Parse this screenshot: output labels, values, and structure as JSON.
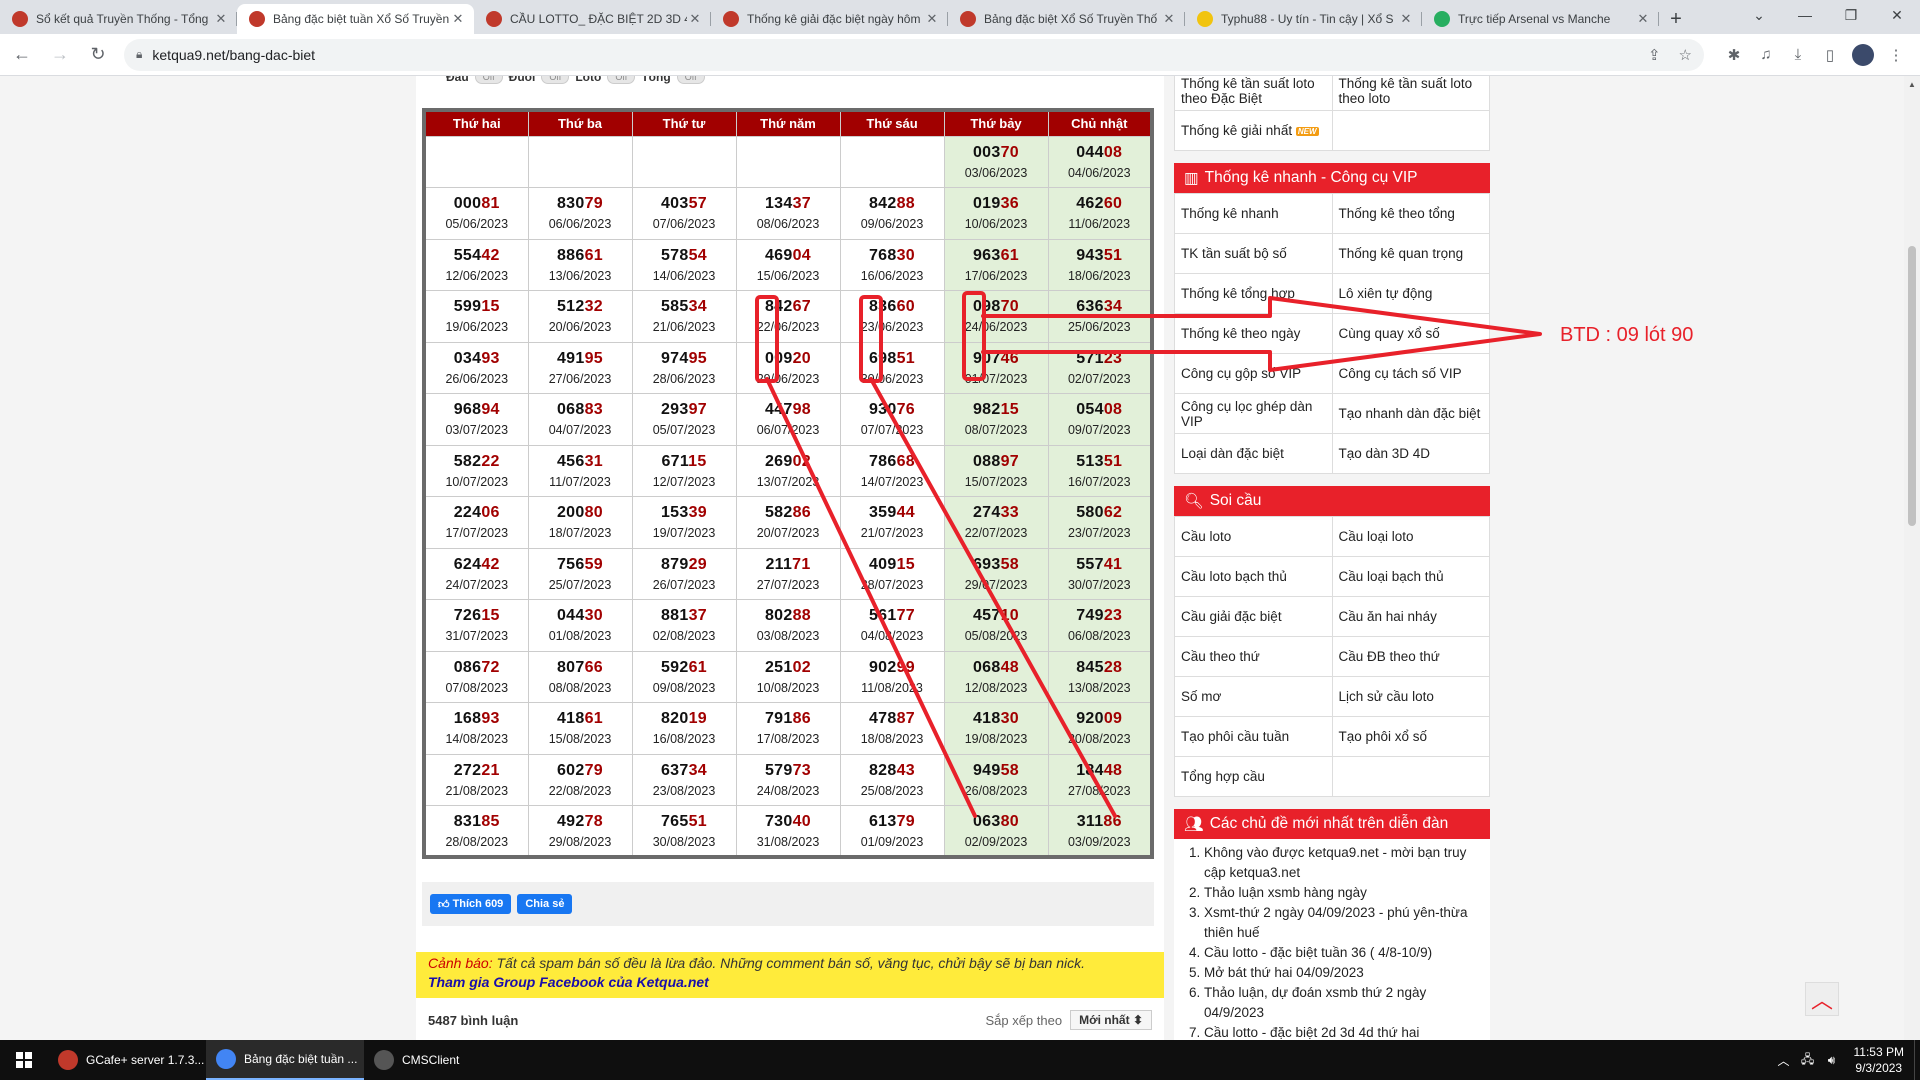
{
  "browser": {
    "tabs": [
      {
        "title": "Sổ kết quả Truyền Thống - Tổng",
        "icon": "ketqua-favicon",
        "color": "#c0392b",
        "active": false
      },
      {
        "title": "Bảng đặc biệt tuần Xổ Số Truyền",
        "icon": "ketqua-favicon",
        "color": "#c0392b",
        "active": true
      },
      {
        "title": "CẦU LOTTO_ ĐẶC BIỆT 2D 3D 4D",
        "icon": "ketqua-favicon",
        "color": "#c0392b",
        "active": false
      },
      {
        "title": "Thống kê giải đặc biệt ngày hôm",
        "icon": "ketqua-favicon",
        "color": "#c0392b",
        "active": false
      },
      {
        "title": "Bảng đặc biệt Xổ Số Truyền Thố",
        "icon": "ketqua-favicon",
        "color": "#c0392b",
        "active": false
      },
      {
        "title": "Typhu88 - Uy tín - Tin cậy | Xổ S",
        "icon": "typhu-favicon",
        "color": "#f1c40f",
        "active": false
      },
      {
        "title": "Trực tiếp Arsenal vs Manche",
        "icon": "live-favicon",
        "color": "#27ae60",
        "active": false
      }
    ],
    "url": "ketqua9.net/bang-dac-biet"
  },
  "filters": {
    "labels": [
      "Đầu",
      "Đuôi",
      "Loto",
      "Tổng"
    ],
    "toggle_text": "Off"
  },
  "table": {
    "headers": [
      "Thứ hai",
      "Thứ ba",
      "Thứ tư",
      "Thứ năm",
      "Thứ sáu",
      "Thứ bảy",
      "Chủ nhật"
    ],
    "rows": [
      [
        {
          "num": "",
          "date": ""
        },
        {
          "num": "",
          "date": ""
        },
        {
          "num": "",
          "date": ""
        },
        {
          "num": "",
          "date": ""
        },
        {
          "num": "",
          "date": ""
        },
        {
          "num": "00370",
          "date": "03/06/2023"
        },
        {
          "num": "04408",
          "date": "04/06/2023"
        }
      ],
      [
        {
          "num": "00081",
          "date": "05/06/2023"
        },
        {
          "num": "83079",
          "date": "06/06/2023"
        },
        {
          "num": "40357",
          "date": "07/06/2023"
        },
        {
          "num": "13437",
          "date": "08/06/2023"
        },
        {
          "num": "84288",
          "date": "09/06/2023"
        },
        {
          "num": "01936",
          "date": "10/06/2023"
        },
        {
          "num": "46260",
          "date": "11/06/2023"
        }
      ],
      [
        {
          "num": "55442",
          "date": "12/06/2023"
        },
        {
          "num": "88661",
          "date": "13/06/2023"
        },
        {
          "num": "57854",
          "date": "14/06/2023"
        },
        {
          "num": "46904",
          "date": "15/06/2023"
        },
        {
          "num": "76830",
          "date": "16/06/2023"
        },
        {
          "num": "96361",
          "date": "17/06/2023"
        },
        {
          "num": "94351",
          "date": "18/06/2023"
        }
      ],
      [
        {
          "num": "59915",
          "date": "19/06/2023"
        },
        {
          "num": "51232",
          "date": "20/06/2023"
        },
        {
          "num": "58534",
          "date": "21/06/2023"
        },
        {
          "num": "84267",
          "date": "22/06/2023"
        },
        {
          "num": "83660",
          "date": "23/06/2023"
        },
        {
          "num": "09870",
          "date": "24/06/2023"
        },
        {
          "num": "63634",
          "date": "25/06/2023"
        }
      ],
      [
        {
          "num": "03493",
          "date": "26/06/2023"
        },
        {
          "num": "49195",
          "date": "27/06/2023"
        },
        {
          "num": "97495",
          "date": "28/06/2023"
        },
        {
          "num": "00920",
          "date": "29/06/2023"
        },
        {
          "num": "69851",
          "date": "30/06/2023"
        },
        {
          "num": "90746",
          "date": "01/07/2023"
        },
        {
          "num": "57123",
          "date": "02/07/2023"
        }
      ],
      [
        {
          "num": "96894",
          "date": "03/07/2023"
        },
        {
          "num": "06883",
          "date": "04/07/2023"
        },
        {
          "num": "29397",
          "date": "05/07/2023"
        },
        {
          "num": "44798",
          "date": "06/07/2023"
        },
        {
          "num": "93076",
          "date": "07/07/2023"
        },
        {
          "num": "98215",
          "date": "08/07/2023"
        },
        {
          "num": "05408",
          "date": "09/07/2023"
        }
      ],
      [
        {
          "num": "58222",
          "date": "10/07/2023"
        },
        {
          "num": "45631",
          "date": "11/07/2023"
        },
        {
          "num": "67115",
          "date": "12/07/2023"
        },
        {
          "num": "26902",
          "date": "13/07/2023"
        },
        {
          "num": "78668",
          "date": "14/07/2023"
        },
        {
          "num": "08897",
          "date": "15/07/2023"
        },
        {
          "num": "51351",
          "date": "16/07/2023"
        }
      ],
      [
        {
          "num": "22406",
          "date": "17/07/2023"
        },
        {
          "num": "20080",
          "date": "18/07/2023"
        },
        {
          "num": "15339",
          "date": "19/07/2023"
        },
        {
          "num": "58286",
          "date": "20/07/2023"
        },
        {
          "num": "35944",
          "date": "21/07/2023"
        },
        {
          "num": "27433",
          "date": "22/07/2023"
        },
        {
          "num": "58062",
          "date": "23/07/2023"
        }
      ],
      [
        {
          "num": "62442",
          "date": "24/07/2023"
        },
        {
          "num": "75659",
          "date": "25/07/2023"
        },
        {
          "num": "87929",
          "date": "26/07/2023"
        },
        {
          "num": "21171",
          "date": "27/07/2023"
        },
        {
          "num": "40915",
          "date": "28/07/2023"
        },
        {
          "num": "69358",
          "date": "29/07/2023"
        },
        {
          "num": "55741",
          "date": "30/07/2023"
        }
      ],
      [
        {
          "num": "72615",
          "date": "31/07/2023"
        },
        {
          "num": "04430",
          "date": "01/08/2023"
        },
        {
          "num": "88137",
          "date": "02/08/2023"
        },
        {
          "num": "80288",
          "date": "03/08/2023"
        },
        {
          "num": "56177",
          "date": "04/08/2023"
        },
        {
          "num": "45710",
          "date": "05/08/2023"
        },
        {
          "num": "74923",
          "date": "06/08/2023"
        }
      ],
      [
        {
          "num": "08672",
          "date": "07/08/2023"
        },
        {
          "num": "80766",
          "date": "08/08/2023"
        },
        {
          "num": "59261",
          "date": "09/08/2023"
        },
        {
          "num": "25102",
          "date": "10/08/2023"
        },
        {
          "num": "90299",
          "date": "11/08/2023"
        },
        {
          "num": "06848",
          "date": "12/08/2023"
        },
        {
          "num": "84528",
          "date": "13/08/2023"
        }
      ],
      [
        {
          "num": "16893",
          "date": "14/08/2023"
        },
        {
          "num": "41861",
          "date": "15/08/2023"
        },
        {
          "num": "82019",
          "date": "16/08/2023"
        },
        {
          "num": "79186",
          "date": "17/08/2023"
        },
        {
          "num": "47887",
          "date": "18/08/2023"
        },
        {
          "num": "41830",
          "date": "19/08/2023"
        },
        {
          "num": "92009",
          "date": "20/08/2023"
        }
      ],
      [
        {
          "num": "27221",
          "date": "21/08/2023"
        },
        {
          "num": "60279",
          "date": "22/08/2023"
        },
        {
          "num": "63734",
          "date": "23/08/2023"
        },
        {
          "num": "57973",
          "date": "24/08/2023"
        },
        {
          "num": "82843",
          "date": "25/08/2023"
        },
        {
          "num": "94958",
          "date": "26/08/2023"
        },
        {
          "num": "18448",
          "date": "27/08/2023"
        }
      ],
      [
        {
          "num": "83185",
          "date": "28/08/2023"
        },
        {
          "num": "49278",
          "date": "29/08/2023"
        },
        {
          "num": "76551",
          "date": "30/08/2023"
        },
        {
          "num": "73040",
          "date": "31/08/2023"
        },
        {
          "num": "61379",
          "date": "01/09/2023"
        },
        {
          "num": "06380",
          "date": "02/09/2023"
        },
        {
          "num": "31186",
          "date": "03/09/2023"
        }
      ]
    ]
  },
  "social": {
    "like": "Thích 609",
    "share": "Chia sẻ"
  },
  "warning": {
    "prefix": "Cảnh báo:",
    "text": " Tất cả spam bán số đều là lừa đảo. Những comment bán số, văng tục, chửi bậy sẽ bị ban nick.",
    "group_link": "Tham gia Group Facebook của Ketqua.net"
  },
  "comments": {
    "count": "5487 bình luận",
    "sort_label": "Sắp xếp theo",
    "sort_value": "Mới nhất ⬍"
  },
  "sidebar": {
    "top_rows": [
      [
        "Thống kê tần suất loto theo Đặc Biệt",
        "Thống kê tần suất loto theo loto"
      ],
      [
        "Thống kê giải nhất",
        ""
      ]
    ],
    "new_badge": "NEW",
    "quick_stats": {
      "title": "Thống kê nhanh - Công cụ VIP",
      "rows": [
        [
          "Thống kê nhanh",
          "Thống kê theo tổng"
        ],
        [
          "TK tần suất bộ số",
          "Thống kê quan trọng"
        ],
        [
          "Thống kê tổng hợp",
          "Lô xiên tự động"
        ],
        [
          "Thống kê theo ngày",
          "Cùng quay xổ số"
        ],
        [
          "Công cụ gộp số VIP",
          "Công cụ tách số VIP"
        ],
        [
          "Công cụ lọc ghép dàn VIP",
          "Tạo nhanh dàn đặc biệt"
        ],
        [
          "Loại dàn đặc biệt",
          "Tạo dàn 3D 4D"
        ]
      ]
    },
    "soi_cau": {
      "title": "Soi cầu",
      "rows": [
        [
          "Cầu loto",
          "Cầu loại loto"
        ],
        [
          "Cầu loto bạch thủ",
          "Cầu loại bạch thủ"
        ],
        [
          "Cầu giải đặc biệt",
          "Cầu ăn hai nháy"
        ],
        [
          "Cầu theo thứ",
          "Cầu ĐB theo thứ"
        ],
        [
          "Số mơ",
          "Lịch sử cầu loto"
        ],
        [
          "Tạo phôi cầu tuần",
          "Tạo phôi xổ số"
        ],
        [
          "Tổng hợp cầu",
          ""
        ]
      ]
    },
    "forum": {
      "title": "Các chủ đề mới nhất trên diễn đàn",
      "items": [
        "Không vào được ketqua9.net - mời bạn truy cập ketqua3.net",
        "Thảo luận xsmb hàng ngày",
        "Xsmt-thứ 2 ngày 04/09/2023 - phú yên-thừa thiên huế",
        "Cầu lotto - đặc biệt tuần 36 ( 4/8-10/9)",
        "Mở bát thứ hai 04/09/2023",
        "Thảo luận, dự đoán xsmb thứ 2 ngày 04/9/2023",
        "Cầu lotto - đặc biệt 2d 3d 4d thứ hai"
      ]
    }
  },
  "annotation": {
    "label": "BTD : 09 lót 90",
    "color": "#e8212a"
  },
  "taskbar": {
    "items": [
      {
        "label": "GCafe+ server 1.7.3...",
        "color": "#c0392b"
      },
      {
        "label": "Bảng đặc biệt tuần ...",
        "color": "#4285f4"
      },
      {
        "label": "CMSClient",
        "color": "#555555"
      }
    ],
    "time": "11:53 PM",
    "date": "9/3/2023"
  }
}
